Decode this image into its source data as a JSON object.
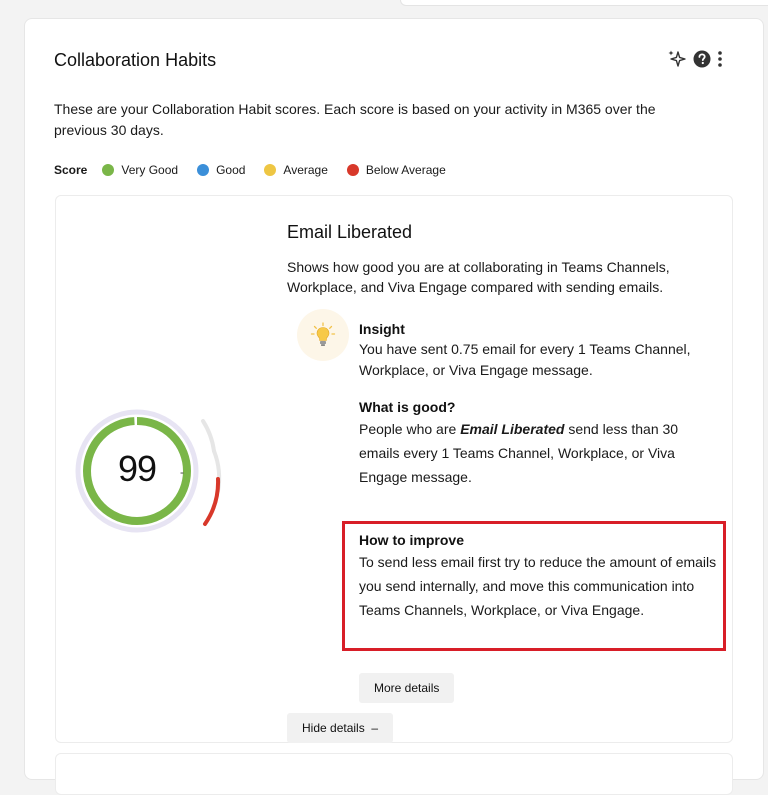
{
  "card": {
    "title": "Collaboration Habits",
    "description": "These are your Collaboration Habit scores. Each score is based on your activity in M365 over the previous 30 days."
  },
  "legend": {
    "label": "Score",
    "items": [
      {
        "label": "Very Good",
        "color": "#7ab648"
      },
      {
        "label": "Good",
        "color": "#3b8fd9"
      },
      {
        "label": "Average",
        "color": "#eec643"
      },
      {
        "label": "Below Average",
        "color": "#d8382a"
      }
    ]
  },
  "icons": [
    "sparkle-icon",
    "help-icon",
    "more-vertical-icon",
    "lightbulb-icon"
  ],
  "habit": {
    "score": "99",
    "score_suffix": "-",
    "score_fraction": 0.99,
    "score_color": "#7ab648",
    "title": "Email Liberated",
    "description": "Shows how good you are at collaborating in Teams Channels, Workplace, and Viva Engage compared with sending emails.",
    "insight": {
      "title": "Insight",
      "body": "You have sent 0.75 email for every 1 Teams Channel, Workplace, or Viva Engage message."
    },
    "what_is_good": {
      "title": "What is good?",
      "body_prefix": "People who are ",
      "body_emphasis": "Email Liberated",
      "body_suffix": " send less than 30 emails every 1 Teams Channel, Workplace, or Viva Engage message."
    },
    "how_to_improve": {
      "title": "How to improve",
      "body": "To send less email first try to reduce the amount of emails you send internally, and move this communication into Teams Channels, Workplace, or Viva Engage."
    },
    "more_details_label": "More details",
    "hide_details_label": "Hide details  –"
  }
}
